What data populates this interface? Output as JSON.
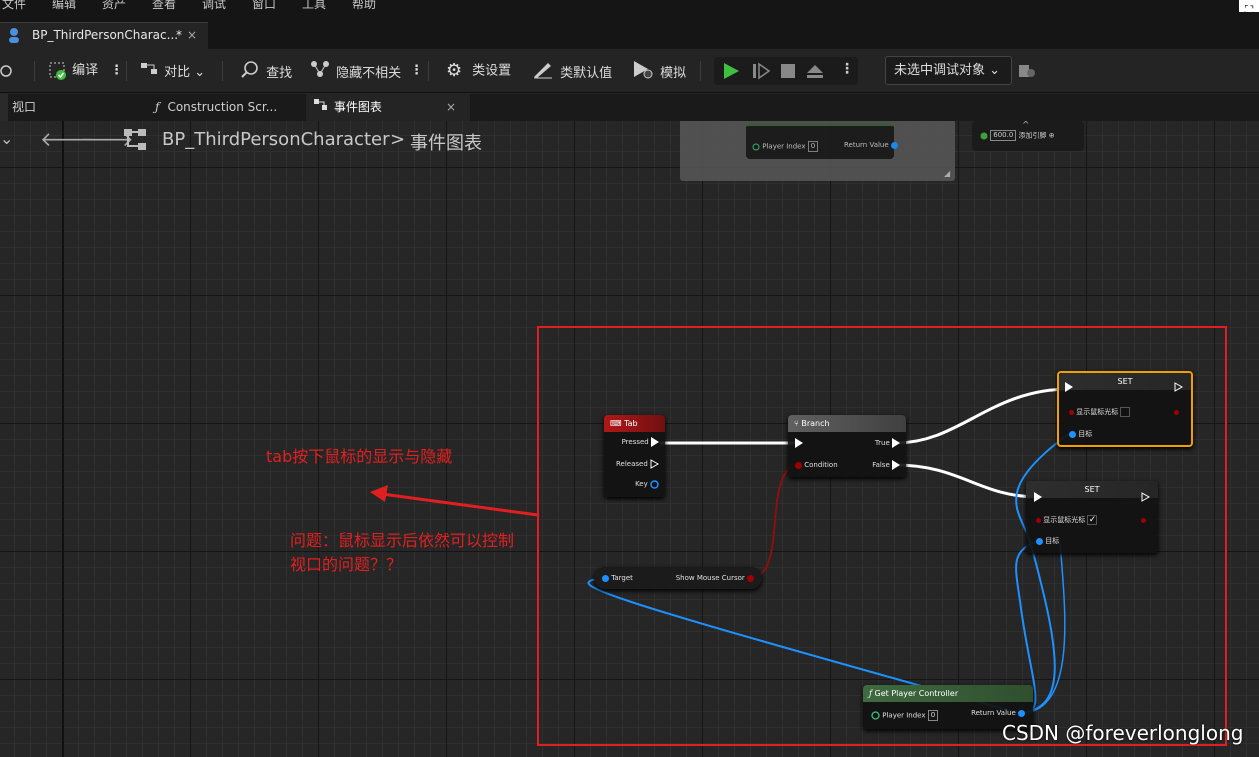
{
  "menubar": {
    "items": [
      "文件",
      "编辑",
      "资产",
      "查看",
      "调试",
      "窗口",
      "工具",
      "帮助"
    ]
  },
  "doc_tab": {
    "title": "BP_ThirdPersonCharac...",
    "modified": "*",
    "close": "×"
  },
  "toolbar": {
    "compile": "编译",
    "diff": "对比",
    "find": "查找",
    "hide_unrelated": "隐藏不相关",
    "class_settings": "类设置",
    "class_defaults": "类默认值",
    "simulate": "模拟",
    "debug_target": "未选中调试对象"
  },
  "subtabs": {
    "viewport": "视口",
    "construction": "Construction Scr...",
    "event_graph": "事件图表",
    "close": "×"
  },
  "breadcrumb": {
    "blueprint": "BP_ThirdPersonCharacter",
    "separator": ">",
    "graph": "事件图表"
  },
  "top_nodes": {
    "player_index": "Player Index",
    "player_index_value": "0",
    "return_value": "Return Value",
    "float_value": "600.0",
    "add_pin": "添加引脚"
  },
  "nodes": {
    "tab": {
      "title": "Tab",
      "pressed": "Pressed",
      "released": "Released",
      "key": "Key"
    },
    "branch": {
      "title": "Branch",
      "condition": "Condition",
      "true": "True",
      "false": "False"
    },
    "set1": {
      "title": "SET",
      "var": "显示鼠标光标",
      "target": "目标",
      "checked": false
    },
    "set2": {
      "title": "SET",
      "var": "显示鼠标光标",
      "target": "目标",
      "checked": true
    },
    "mouse": {
      "target": "Target",
      "var": "Show Mouse Cursor"
    },
    "gpc": {
      "title": "Get Player Controller",
      "player_index": "Player Index",
      "player_index_value": "0",
      "return_value": "Return Value"
    }
  },
  "annotations": {
    "label1": "tab按下鼠标的显示与隐藏",
    "label2_line1": "问题：鼠标显示后依然可以控制",
    "label2_line2": "视口的问题？？",
    "highlight_color": "#e02020"
  },
  "watermark": "CSDN @foreverlonglong",
  "colors": {
    "accent": "#1e90ff",
    "play": "#3fbf3f",
    "selected_node": "#f0a000",
    "bool_pin": "#a00000"
  }
}
